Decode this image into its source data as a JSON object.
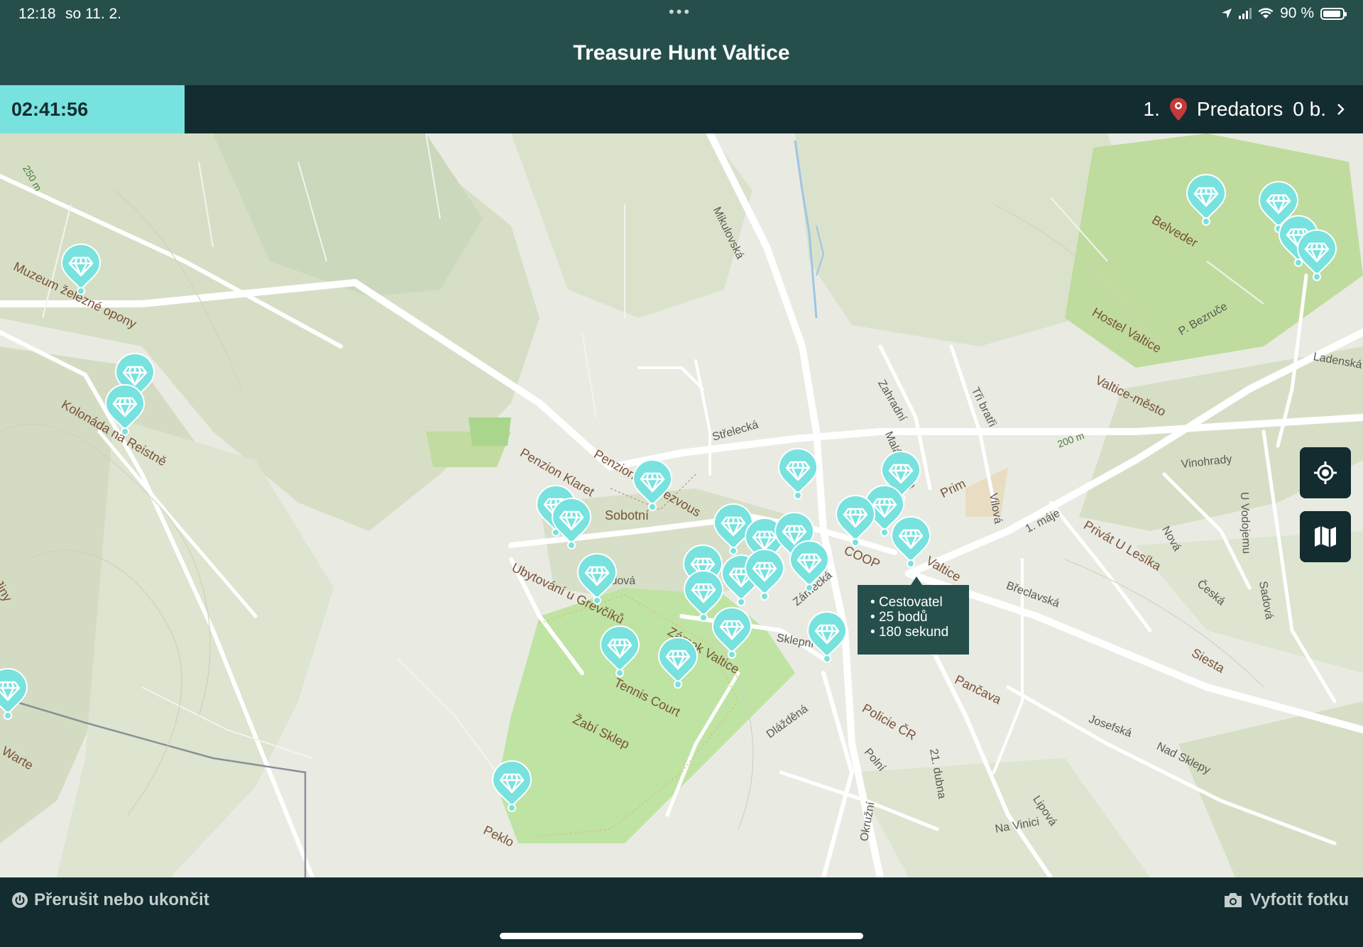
{
  "status_bar": {
    "time": "12:18",
    "date": "so 11. 2.",
    "battery": "90 %"
  },
  "header": {
    "title": "Treasure Hunt Valtice"
  },
  "timer": {
    "value": "02:41:56"
  },
  "team": {
    "rank": "1.",
    "name": "Predators",
    "points": "0 b."
  },
  "tooltip": {
    "lines": [
      "Cestovatel",
      "25 bodů",
      "180 sekund"
    ]
  },
  "map": {
    "labels": [
      "Muzeum železné opony",
      "Kolonáda na Reistně",
      "Penzion Klaret",
      "Penzion Rendezvous",
      "Sobotní",
      "Ubytování u Grevčíků",
      "Zámek Valtice",
      "Tennis Court",
      "Žabí Sklep",
      "Peklo",
      "Belveder",
      "Hostel Valtice",
      "P. Bezruče",
      "Valtice-město",
      "Mikulovská",
      "Střelecká",
      "Zahradní",
      "Malá Strana",
      "Tři bratři",
      "Prim",
      "Vilová",
      "COOP",
      "Valtice",
      "Břeclavská",
      "1. máje",
      "Privát U Lesíka",
      "Nová",
      "Česká",
      "Sadová",
      "U Vodojemu",
      "Vinohrady",
      "Ladenská cesta",
      "Siesta",
      "Josefská",
      "Nad Sklepy",
      "Pančava",
      "Policie ČR",
      "Polní",
      "21. dubna",
      "Lipová",
      "Na Vinici",
      "Okružní",
      "Dlážděná",
      "Sklepní",
      "Zámecká",
      "Lidová",
      "Jiny",
      "Warte",
      "250 m",
      "200 m"
    ]
  },
  "actions": {
    "interrupt": "Přerušit nebo ukončit",
    "photo": "Vyfotit fotku"
  },
  "colors": {
    "header": "#264f4b",
    "bar": "#132c2f",
    "accent": "#78e2df",
    "map_bg": "#e9ebe3",
    "forest": "#d3dcc2",
    "park": "#bfe3a3"
  },
  "icons": [
    "location-arrow-icon",
    "signal-icon",
    "wifi-icon",
    "battery-icon",
    "map-pin-icon",
    "chevron-right-icon",
    "diamond-marker-icon",
    "locate-me-icon",
    "map-layers-icon",
    "power-icon",
    "camera-icon"
  ]
}
